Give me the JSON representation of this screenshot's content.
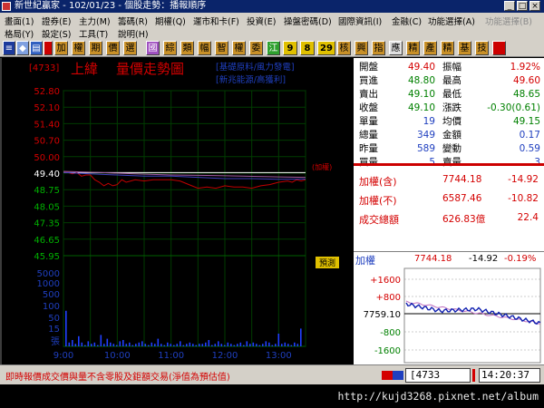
{
  "window": {
    "title": "新世紀贏家 - 102/01/23 - 個股走勢：播報順序"
  },
  "menu": {
    "row1": [
      "畫面(1)",
      "證券(E)",
      "主力(M)",
      "籌碼(R)",
      "期權(Q)",
      "運市和卡(F)",
      "投資(E)",
      "操盤密碼(D)",
      "國際資訊(I)",
      "金融(C)",
      "功能選擇(A)",
      "功能選擇(B)"
    ],
    "row2": [
      "格局(Y)",
      "設定(S)",
      "工具(T)",
      "說明(H)"
    ]
  },
  "toolbar": {
    "buttons": [
      "加",
      "權",
      "期",
      "價",
      "選",
      "國",
      "綜",
      "類",
      "幅",
      "智",
      "權",
      "委",
      "江",
      "9",
      "8",
      "29",
      "核",
      "興",
      "指",
      "應",
      "精",
      "產",
      "精",
      "基",
      "技"
    ]
  },
  "chart": {
    "stock_code": "4733",
    "stock_name": "上緯",
    "chart_title": "量價走勢圖",
    "tags_line1": "基礎原料/風力發電",
    "tags_line2": "新兆能源/高獲利",
    "price_ticks": [
      "52.80",
      "52.10",
      "51.40",
      "50.70",
      "50.00",
      "49.40",
      "48.75",
      "48.05",
      "47.35",
      "46.65",
      "45.95"
    ],
    "volume_ticks": [
      "5000",
      "1000",
      "500",
      "100",
      "50",
      "15",
      "張"
    ],
    "time_ticks": [
      "9:00",
      "10:00",
      "11:00",
      "12:00",
      "13:00"
    ],
    "index_label": "(加權)",
    "forecast_label": "預測"
  },
  "chart_data": {
    "type": "line",
    "title": "量價走勢圖",
    "xlabel": "",
    "ylabel": "",
    "x_range": [
      "9:00",
      "13:30"
    ],
    "ylim": [
      45.95,
      52.8
    ],
    "reference_price": 49.4,
    "series": [
      {
        "color": "#c00000",
        "points": [
          [
            0,
            49.4
          ],
          [
            5,
            49.4
          ],
          [
            10,
            49.35
          ],
          [
            15,
            49.4
          ],
          [
            20,
            49.25
          ],
          [
            25,
            49.3
          ],
          [
            30,
            49.3
          ],
          [
            35,
            49.1
          ],
          [
            40,
            49.0
          ],
          [
            45,
            48.85
          ],
          [
            50,
            48.95
          ],
          [
            55,
            48.85
          ],
          [
            60,
            48.9
          ],
          [
            65,
            49.1
          ],
          [
            70,
            49.0
          ],
          [
            75,
            49.05
          ],
          [
            80,
            49.1
          ],
          [
            90,
            49.05
          ],
          [
            100,
            49.1
          ],
          [
            110,
            49.1
          ],
          [
            120,
            49.1
          ],
          [
            130,
            49.05
          ],
          [
            140,
            48.9
          ],
          [
            150,
            48.75
          ],
          [
            160,
            48.8
          ],
          [
            170,
            48.75
          ],
          [
            180,
            48.85
          ],
          [
            190,
            48.8
          ],
          [
            200,
            48.8
          ],
          [
            210,
            48.75
          ],
          [
            220,
            48.85
          ],
          [
            230,
            48.9
          ],
          [
            240,
            49.0
          ],
          [
            250,
            49.05
          ],
          [
            255,
            49.0
          ],
          [
            260,
            49.1
          ],
          [
            265,
            49.05
          ],
          [
            270,
            49.1
          ]
        ]
      },
      {
        "color": "#4040c0",
        "points": [
          [
            0,
            49.4
          ],
          [
            30,
            49.35
          ],
          [
            60,
            49.3
          ],
          [
            90,
            49.25
          ],
          [
            120,
            49.25
          ],
          [
            150,
            49.2
          ],
          [
            180,
            49.15
          ],
          [
            210,
            49.15
          ],
          [
            240,
            49.12
          ],
          [
            270,
            49.13
          ]
        ]
      },
      {
        "color": "#a05aa0",
        "points": [
          [
            0,
            49.45
          ],
          [
            40,
            49.4
          ],
          [
            80,
            49.35
          ],
          [
            120,
            49.3
          ],
          [
            160,
            49.28
          ],
          [
            200,
            49.25
          ],
          [
            240,
            49.22
          ],
          [
            270,
            49.2
          ]
        ]
      }
    ]
  },
  "quote": {
    "rows": [
      {
        "l1": "開盤",
        "v1": "49.40",
        "v1c": "#d40000",
        "l2": "振幅",
        "v2": "1.92%",
        "v2c": "#d40000"
      },
      {
        "l1": "買進",
        "v1": "48.80",
        "v1c": "#008000",
        "l2": "最高",
        "v2": "49.60",
        "v2c": "#d40000"
      },
      {
        "l1": "賣出",
        "v1": "49.10",
        "v1c": "#008000",
        "l2": "最低",
        "v2": "48.65",
        "v2c": "#008000"
      },
      {
        "l1": "收盤",
        "v1": "49.10",
        "v1c": "#008000",
        "l2": "漲跌",
        "v2": "-0.30(0.61)",
        "v2c": "#008000"
      },
      {
        "l1": "單量",
        "v1": "19",
        "v1c": "#1f3fbf",
        "l2": "均價",
        "v2": "49.15",
        "v2c": "#008000"
      },
      {
        "l1": "總量",
        "v1": "349",
        "v1c": "#1f3fbf",
        "l2": "金額",
        "v2": "0.17",
        "v2c": "#1f3fbf"
      },
      {
        "l1": "昨量",
        "v1": "589",
        "v1c": "#1f3fbf",
        "l2": "變動",
        "v2": "0.59",
        "v2c": "#1f3fbf"
      },
      {
        "l1": "買量",
        "v1": "5",
        "v1c": "#1f3fbf",
        "l2": "賣量",
        "v2": "3",
        "v2c": "#1f3fbf"
      }
    ]
  },
  "index_summary": {
    "rows": [
      {
        "label": "加權(含)",
        "value": "7744.18",
        "change": "-14.92"
      },
      {
        "label": "加權(不)",
        "value": "6587.46",
        "change": "-10.82"
      },
      {
        "label": "成交總額",
        "value": "626.83億",
        "change": "22.4"
      }
    ]
  },
  "mini": {
    "label": "加權",
    "value": "7744.18",
    "change": "-14.92",
    "pct": "-0.19%",
    "ticks": [
      "+1600",
      "+800",
      "7759.10",
      "-800",
      "-1600"
    ]
  },
  "status": {
    "note": "即時報價成交價與量不含零股及鉅額交易(淨值為預估值)",
    "code": "4733",
    "time": "14:20:37"
  },
  "url": "http://kujd3268.pixnet.net/album",
  "colors": {
    "up": "#d40000",
    "down": "#008000",
    "accent": "#1f3fbf",
    "chart_bg": "#000000",
    "grid": "#003c00"
  }
}
